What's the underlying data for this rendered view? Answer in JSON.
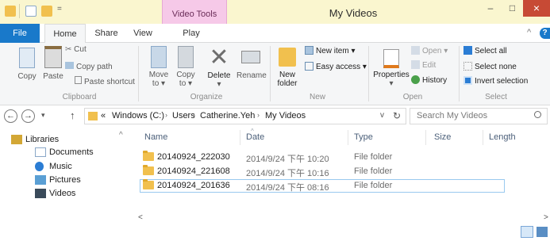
{
  "window": {
    "title": "My Videos",
    "context_tab": "Video Tools",
    "buttons": {
      "minimize": "–",
      "maximize": "□",
      "close": "×"
    }
  },
  "tabs": [
    "File",
    "Home",
    "Share",
    "View",
    "Play"
  ],
  "ribbon_right": {
    "collapse": "^",
    "help": "?"
  },
  "ribbon": {
    "clipboard": {
      "label": "Clipboard",
      "copy": "Copy",
      "paste": "Paste",
      "cut": "Cut",
      "copy_path": "Copy path",
      "paste_shortcut": "Paste shortcut"
    },
    "organize": {
      "label": "Organize",
      "move_to": [
        "Move",
        "to ▾"
      ],
      "copy_to": [
        "Copy",
        "to ▾"
      ],
      "delete": "Delete",
      "delete_arrow": "▾",
      "rename": "Rename"
    },
    "new": {
      "label": "New",
      "new_folder": [
        "New",
        "folder"
      ],
      "new_item": "New item ▾",
      "easy_access": "Easy access ▾"
    },
    "open": {
      "label": "Open",
      "properties": "Properties",
      "properties_arrow": "▾",
      "open": "Open ▾",
      "edit": "Edit",
      "history": "History"
    },
    "select": {
      "label": "Select",
      "select_all": "Select all",
      "select_none": "Select none",
      "invert": "Invert selection"
    }
  },
  "address": {
    "back": "←",
    "forward": "→",
    "recent": "▾",
    "up": "↑",
    "overflow": "«",
    "crumbs": [
      "Windows (C:)",
      "Users",
      "Catherine.Yeh",
      "My Videos"
    ],
    "separator": "›",
    "dropdown": "v",
    "refresh": "↻",
    "search_placeholder": "Search My Videos"
  },
  "nav": {
    "items": [
      {
        "label": "Libraries",
        "icon": "libraries-icon"
      },
      {
        "label": "Documents",
        "icon": "documents-icon"
      },
      {
        "label": "Music",
        "icon": "music-icon"
      },
      {
        "label": "Pictures",
        "icon": "pictures-icon"
      },
      {
        "label": "Videos",
        "icon": "videos-icon"
      }
    ],
    "scroll_up": "^",
    "scroll_down": "v"
  },
  "columns": [
    "Name",
    "Date",
    "Type",
    "Size",
    "Length"
  ],
  "files": [
    {
      "name": "20140924_222030",
      "date": "2014/9/24 下午 10:20",
      "type": "File folder",
      "selected": false
    },
    {
      "name": "20140924_221608",
      "date": "2014/9/24 下午 10:16",
      "type": "File folder",
      "selected": false
    },
    {
      "name": "20140924_201636",
      "date": "2014/9/24 下午 08:16",
      "type": "File folder",
      "selected": true
    }
  ],
  "scroll": {
    "left": "<",
    "right": ">"
  },
  "colors": {
    "title_bg": "#faf6cf",
    "context_tab": "#f6c9e8",
    "file_tab": "#1979ca",
    "close": "#c74a35",
    "folder": "#f1c04e",
    "selection": "#99c9ef"
  }
}
